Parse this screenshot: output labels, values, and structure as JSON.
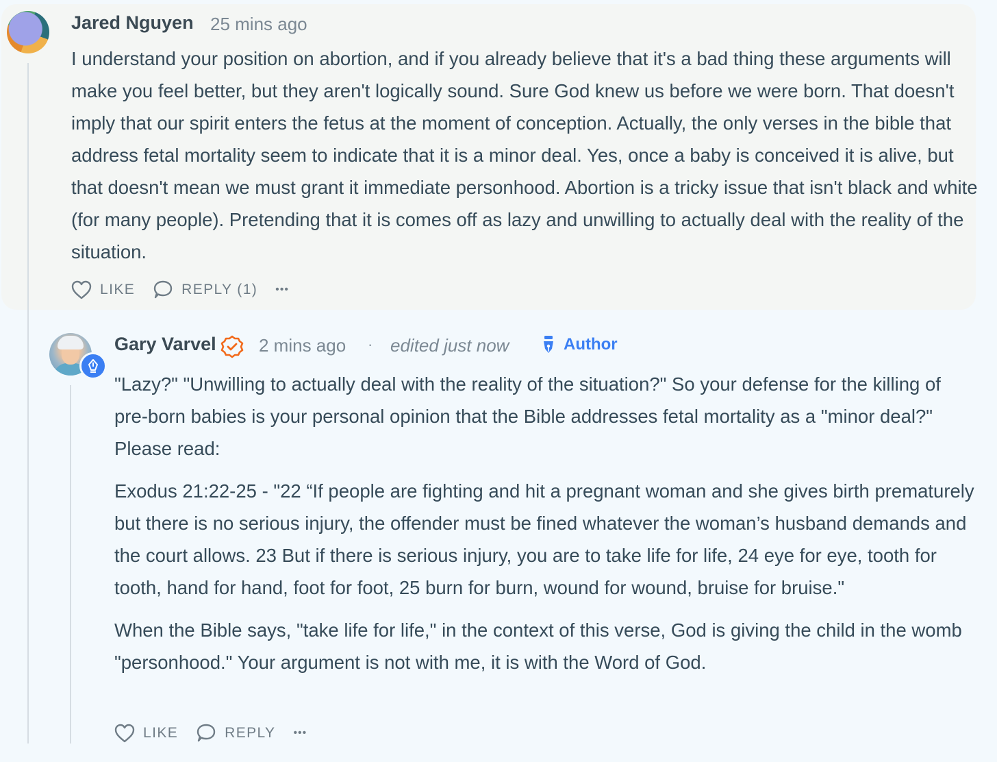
{
  "parent_comment": {
    "author": "Jared Nguyen",
    "timestamp": "25 mins ago",
    "body": "I understand your position on abortion, and if you already believe that it's a bad thing these arguments will make you feel better, but they aren't logically sound. Sure God knew us before we were born. That doesn't imply that our spirit enters the fetus at the moment of conception. Actually, the only verses in the bible that address fetal mortality seem to indicate that it is a minor deal. Yes, once a baby is conceived it is alive, but that doesn't mean we must grant it immediate personhood. Abortion is a tricky issue that isn't black and white (for many people). Pretending that it is comes off as lazy and unwilling to actually deal with the reality of the situation.",
    "like_label": "LIKE",
    "reply_label": "REPLY (1)",
    "more_label": "•••"
  },
  "reply_comment": {
    "author": "Gary Varvel",
    "timestamp": "2 mins ago",
    "separator": "·",
    "edited": "edited just now",
    "author_badge": "Author",
    "paragraphs": [
      "\"Lazy?\" \"Unwilling to actually deal with the reality of the situation?\" So your defense for the killing of pre-born babies is your personal opinion that the Bible addresses fetal mortality as a \"minor deal?\" Please read:",
      "Exodus 21:22-25 - \"22 “If people are fighting and hit a pregnant woman and she gives birth prematurely but there is no serious injury, the offender must be fined whatever the woman’s husband demands and the court allows. 23 But if there is serious injury, you are to take life for life, 24 eye for eye, tooth for tooth, hand for hand, foot for foot, 25 burn for burn, wound for wound, bruise for bruise.\"",
      "When the Bible says, \"take life for life,\" in the context of this verse, God is giving the child in the womb \"personhood.\" Your argument is not with me, it is with the Word of God."
    ],
    "like_label": "LIKE",
    "reply_label": "REPLY",
    "more_label": "•••"
  },
  "colors": {
    "page_bg": "#f3f9fd",
    "parent_bg": "#f4f6f4",
    "text": "#364b59",
    "accent_blue": "#3b7ff3",
    "verified_orange": "#f26a1b"
  }
}
